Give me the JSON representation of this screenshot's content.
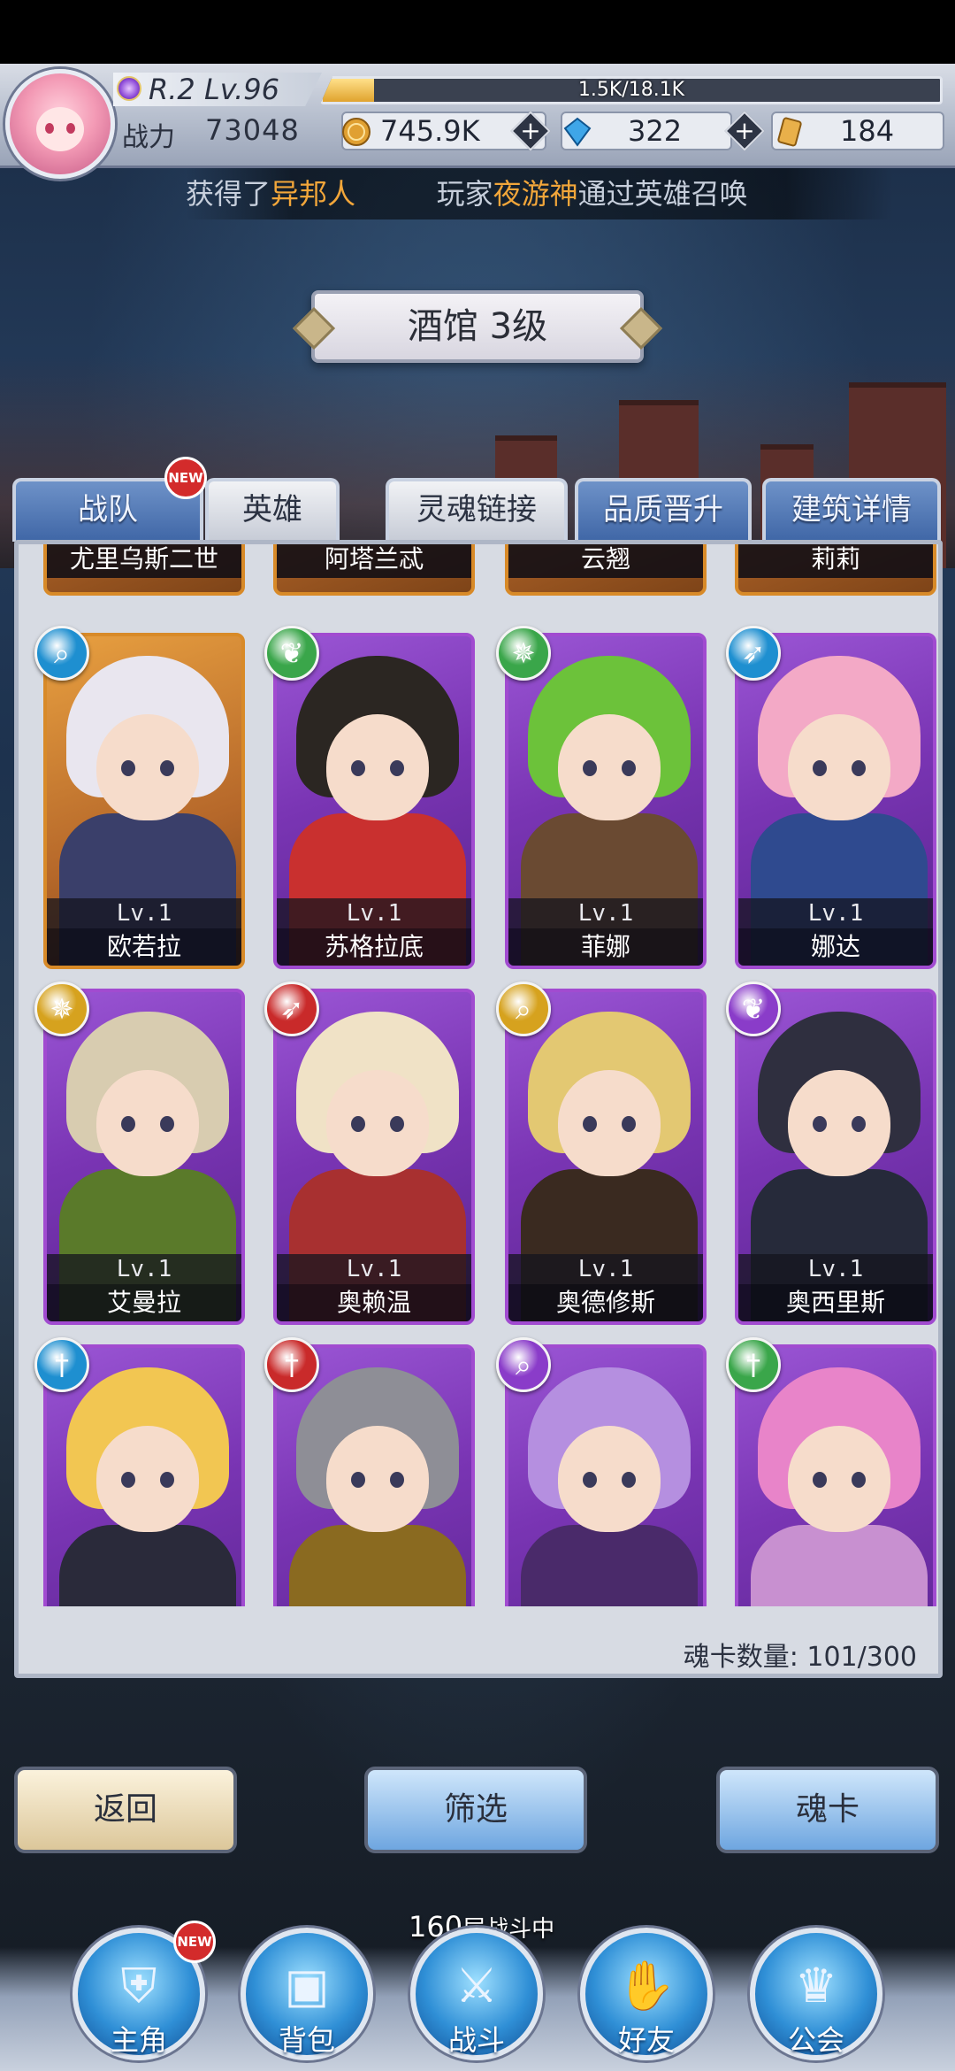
{
  "player": {
    "rank": "R.2 Lv.96",
    "exp_text": "1.5K/18.1K",
    "exp_fraction": 0.083,
    "power_label": "战力",
    "power_value": "73048"
  },
  "resources": {
    "gold": "745.9K",
    "diamonds": "322",
    "cards": "184"
  },
  "marquee": {
    "prefix": "获得了",
    "hero": "异邦人",
    "mid": "玩家",
    "player": "夜游神",
    "suffix": "通过英雄召唤"
  },
  "title": "酒馆 3级",
  "tabs": [
    {
      "label": "战队",
      "badge": "NEW"
    },
    {
      "label": "英雄"
    },
    {
      "label": "灵魂链接"
    },
    {
      "label": "品质晋升"
    },
    {
      "label": "建筑详情"
    }
  ],
  "partial_row": [
    "尤里乌斯二世",
    "阿塔兰忒",
    "云翘",
    "莉莉"
  ],
  "partial_lv": "Lv.1",
  "heroes": [
    {
      "name": "欧若拉",
      "level": "Lv.1",
      "elem": "staff",
      "elem_color": "#1e8fd0"
    },
    {
      "name": "苏格拉底",
      "level": "Lv.1",
      "elem": "wing",
      "elem_color": "#3aa64a"
    },
    {
      "name": "菲娜",
      "level": "Lv.1",
      "elem": "shuriken",
      "elem_color": "#3aa64a"
    },
    {
      "name": "娜达",
      "level": "Lv.1",
      "elem": "bow",
      "elem_color": "#1e8fd0"
    },
    {
      "name": "艾曼拉",
      "level": "Lv.1",
      "elem": "shuriken",
      "elem_color": "#d6a21e"
    },
    {
      "name": "奥赖温",
      "level": "Lv.1",
      "elem": "bow",
      "elem_color": "#c92a2a"
    },
    {
      "name": "奥德修斯",
      "level": "Lv.1",
      "elem": "staff",
      "elem_color": "#d6a21e"
    },
    {
      "name": "奥西里斯",
      "level": "Lv.1",
      "elem": "wing",
      "elem_color": "#8a3cc9"
    },
    {
      "name": "",
      "level": "",
      "elem": "sword",
      "elem_color": "#1e8fd0"
    },
    {
      "name": "",
      "level": "",
      "elem": "sword",
      "elem_color": "#c92a2a"
    },
    {
      "name": "",
      "level": "",
      "elem": "staff",
      "elem_color": "#8a3cc9"
    },
    {
      "name": "",
      "level": "",
      "elem": "sword",
      "elem_color": "#3aa64a"
    }
  ],
  "card_count": "魂卡数量: 101/300",
  "buttons": {
    "back": "返回",
    "filter": "筛选",
    "soulcard": "魂卡"
  },
  "floor_progress": {
    "number": "160",
    "text": "层战斗中"
  },
  "nav": [
    {
      "label": "主角",
      "badge": "NEW",
      "icon": "helmet-icon"
    },
    {
      "label": "背包",
      "icon": "backpack-icon"
    },
    {
      "label": "战斗",
      "icon": "crossed-swords-icon"
    },
    {
      "label": "好友",
      "icon": "handshake-icon"
    },
    {
      "label": "公会",
      "icon": "guild-crest-icon"
    }
  ]
}
